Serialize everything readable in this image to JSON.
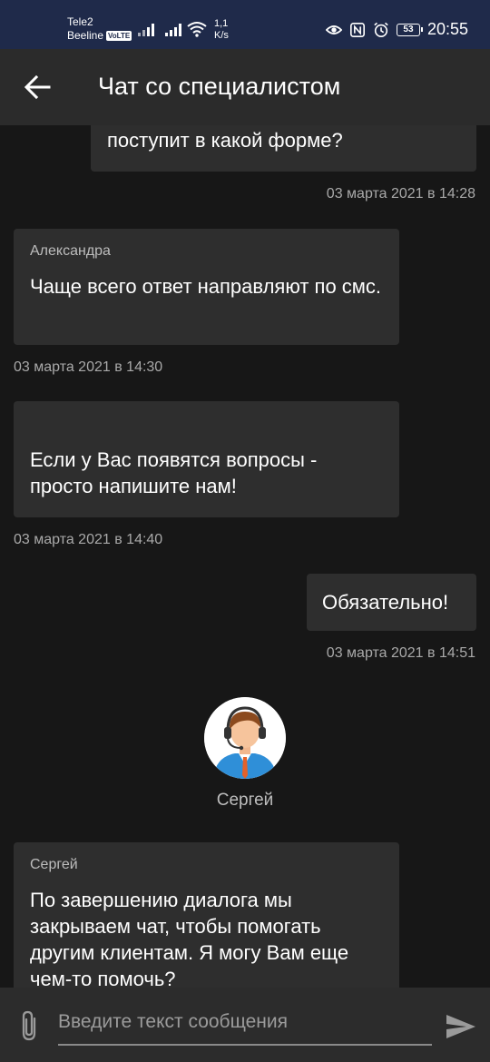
{
  "status_bar": {
    "carrier1": "Tele2",
    "carrier2": "Beeline",
    "volte": "VoLTE",
    "speed_value": "1,1",
    "speed_unit": "K/s",
    "battery": "53",
    "time": "20:55"
  },
  "toolbar": {
    "title": "Чат со специалистом"
  },
  "messages": [
    {
      "side": "right",
      "sender": "",
      "text": "поступит в какой форме?",
      "timestamp": "03 марта 2021 в 14:28"
    },
    {
      "side": "left",
      "sender": "Александра",
      "text": "Чаще всего ответ направляют по смс.",
      "timestamp": "03 марта 2021 в 14:30"
    },
    {
      "side": "left",
      "sender": "",
      "text": "Если у Вас появятся вопросы - просто напишите нам!",
      "timestamp": "03 марта 2021 в 14:40"
    },
    {
      "side": "right",
      "sender": "",
      "text": "Обязательно!",
      "timestamp": "03 марта 2021 в 14:51"
    },
    {
      "side": "left",
      "sender": "Сергей",
      "text": "По завершению диалога мы закрываем чат, чтобы помогать другим клиентам. Я могу Вам еще чем-то помочь?",
      "timestamp": ""
    }
  ],
  "operator": {
    "name": "Сергей",
    "avatar_icon": "operator-headset-avatar"
  },
  "input": {
    "placeholder": "Введите текст сообщения",
    "value": ""
  },
  "icons": {
    "back": "back-arrow-icon",
    "attach": "paperclip-icon",
    "send": "send-icon"
  },
  "colors": {
    "status_bar": "#1f2a4a",
    "toolbar": "#2b2b2b",
    "background": "#171717",
    "bubble": "#2e2e2e"
  }
}
